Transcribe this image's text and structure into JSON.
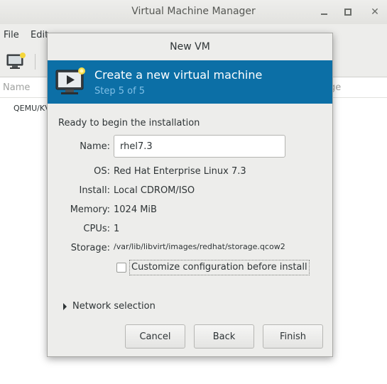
{
  "main_window": {
    "title": "Virtual Machine Manager",
    "menu": {
      "file": "File",
      "edit": "Edit"
    },
    "list": {
      "col_name": "Name",
      "col_usage": "ge",
      "row_connection": "QEMU/KVM"
    }
  },
  "dialog": {
    "title": "New VM",
    "banner": {
      "title": "Create a new virtual machine",
      "step": "Step 5 of 5"
    },
    "ready_text": "Ready to begin the installation",
    "name_label": "Name:",
    "name_value": "rhel7.3",
    "os_label": "OS:",
    "os_value": "Red Hat Enterprise Linux 7.3",
    "install_label": "Install:",
    "install_value": "Local CDROM/ISO",
    "memory_label": "Memory:",
    "memory_value": "1024 MiB",
    "cpus_label": "CPUs:",
    "cpus_value": "1",
    "storage_label": "Storage:",
    "storage_value": "/var/lib/libvirt/images/redhat/storage.qcow2",
    "customize_label": "Customize configuration before install",
    "customize_checked": false,
    "network_label": "Network selection",
    "buttons": {
      "cancel": "Cancel",
      "back": "Back",
      "finish": "Finish"
    }
  },
  "colors": {
    "banner_bg": "#0c6fa6",
    "banner_step": "#7fbfe6",
    "dialog_bg": "#ededeb"
  }
}
